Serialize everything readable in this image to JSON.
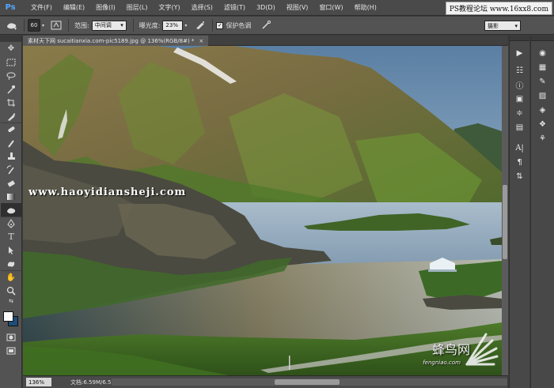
{
  "app": {
    "logo": "Ps"
  },
  "menu": [
    "文件(F)",
    "编辑(E)",
    "图像(I)",
    "图层(L)",
    "文字(Y)",
    "选择(S)",
    "滤镜(T)",
    "3D(D)",
    "视图(V)",
    "窗口(W)",
    "帮助(H)"
  ],
  "watermark_top": "PS教程论坛 www.16xx8.com",
  "options": {
    "brush_size": "60",
    "range_label": "范围:",
    "range_value": "中间调",
    "exposure_label": "曝光度:",
    "exposure_value": "23%",
    "protect_label": "保护色调",
    "protect_checked": "✓",
    "workspace": "摄影"
  },
  "document": {
    "tab_title": "素材天下网 sucaitianxia.com-pic5189.jpg @ 136%(RGB/8#) *",
    "tab_close": "×"
  },
  "status": {
    "zoom": "136%",
    "doc_size": "文档:6.59M/6.59M"
  },
  "canvas_watermarks": {
    "site": "www.haoyidiansheji.com",
    "brand": "蜂鸟网",
    "url": "fengniao.com"
  },
  "colors": {
    "accent": "#54a8ff",
    "foreground": "#fafafa",
    "background": "#1d4d78"
  }
}
